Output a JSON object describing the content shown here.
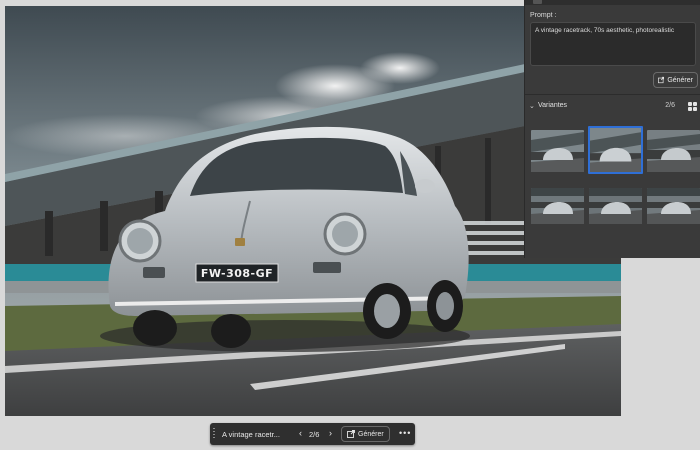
{
  "panel": {
    "prompt_label": "Prompt :",
    "prompt_text": "A vintage racetrack, 70s aesthetic, photorealistic",
    "generate_label": "Générer",
    "variants_label": "Variantes",
    "variants_count": "2/6",
    "variants_selected_index": 1,
    "variants_total": 6
  },
  "ctxbar": {
    "prompt_preview": "A vintage racetr...",
    "counter": "2/6",
    "generate_label": "Générer",
    "more_label": "•••"
  },
  "photo": {
    "plate": "FW-308-GF",
    "plate_small": "FW-308-GF"
  },
  "icons": {
    "generate": "generate-icon",
    "prev": "chevron-left-icon",
    "next": "chevron-right-icon",
    "more": "more-icon",
    "grid": "grid-icon",
    "collapse": "chevron-down-icon"
  },
  "colors": {
    "selection": "#2f6fd6",
    "panel_bg": "#3a3a3a",
    "bar_bg": "#2f2f2f"
  }
}
